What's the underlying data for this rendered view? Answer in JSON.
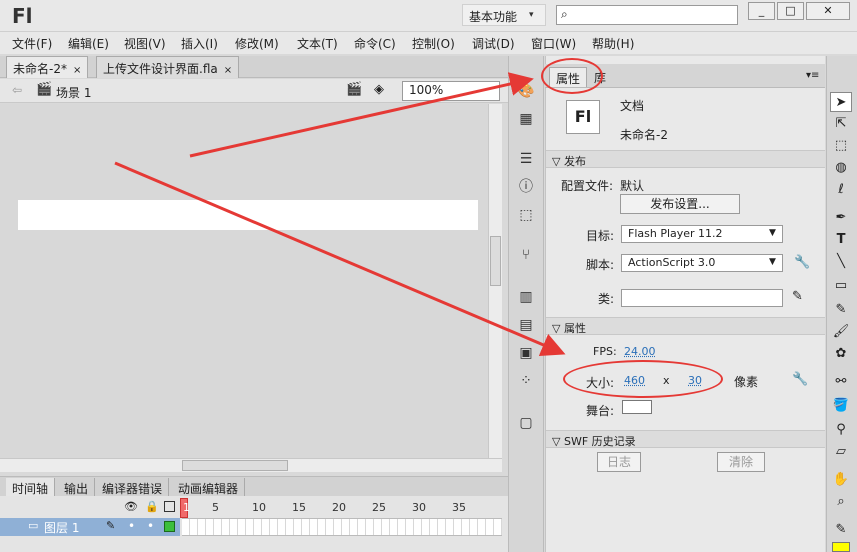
{
  "app": {
    "logo": "Fl",
    "workspace": "基本功能",
    "search_placeholder": "",
    "window_buttons": [
      "_",
      "□",
      "✕"
    ]
  },
  "menu": [
    "文件(F)",
    "编辑(E)",
    "视图(V)",
    "插入(I)",
    "修改(M)",
    "文本(T)",
    "命令(C)",
    "控制(O)",
    "调试(D)",
    "窗口(W)",
    "帮助(H)"
  ],
  "doc_tabs": [
    {
      "label": "未命名-2*",
      "close": "×"
    },
    {
      "label": "上传文件设计界面.fla",
      "close": "×"
    }
  ],
  "scene": {
    "label": "场景 1",
    "zoom": "100%"
  },
  "timeline": {
    "tabs": [
      "时间轴",
      "输出",
      "编译器错误",
      "动画编辑器"
    ],
    "ruler": [
      "1",
      "5",
      "10",
      "15",
      "20",
      "25",
      "30",
      "35"
    ],
    "layer_name": "图层 1"
  },
  "properties": {
    "tabs": [
      "属性",
      "库"
    ],
    "doc_icon": "Fl",
    "doc_type": "文档",
    "doc_name": "未命名-2",
    "publish_section": "发布",
    "profile_label": "配置文件:",
    "profile_value": "默认",
    "publish_settings_button": "发布设置...",
    "target_label": "目标:",
    "target_value": "Flash Player 11.2",
    "script_label": "脚本:",
    "script_value": "ActionScript 3.0",
    "class_label": "类:",
    "props_section": "属性",
    "fps_label": "FPS:",
    "fps_value": "24.00",
    "size_label": "大小:",
    "width": "460",
    "x": "x",
    "height": "30",
    "unit": "像素",
    "stage_label": "舞台:",
    "swf_section": "SWF 历史记录",
    "log_button": "日志",
    "clear_button": "清除"
  },
  "colors": {
    "annotation": "#e53935",
    "stage": "#ffffff"
  }
}
